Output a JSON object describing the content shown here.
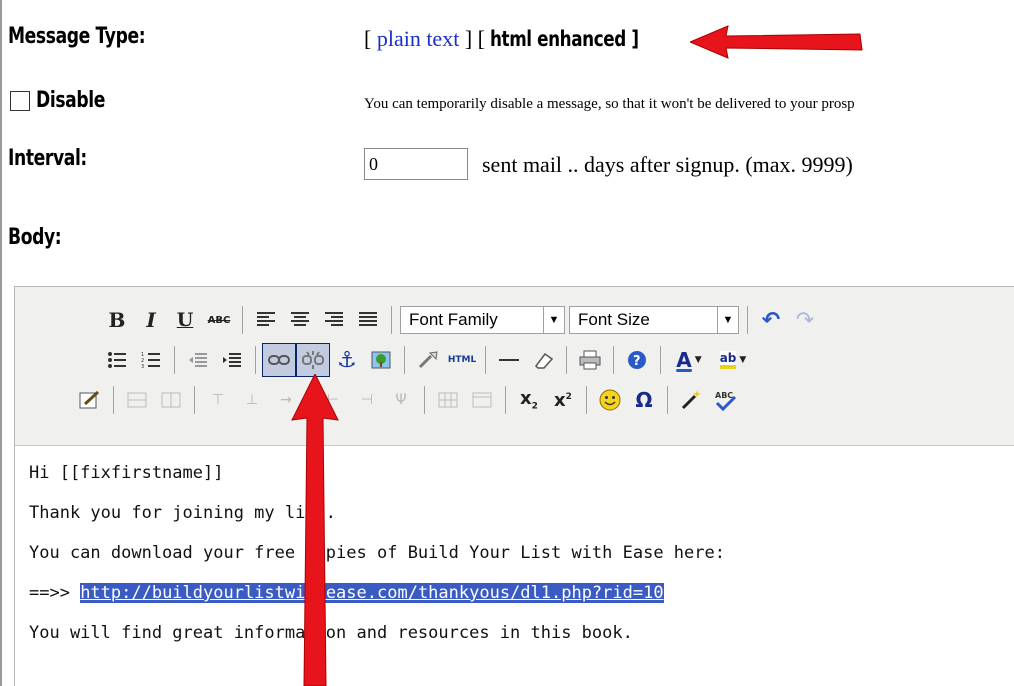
{
  "form": {
    "message_type_label": "Message Type:",
    "message_type": {
      "bracket_open_1": "[ ",
      "plain_text": "plain text",
      "bracket_mid": " ] [ ",
      "html_enhanced": "html enhanced",
      "bracket_close": " ]"
    },
    "disable_label": "Disable",
    "disable_checked": false,
    "disable_hint": "You can temporarily disable a message, so that it won't be delivered to your prosp",
    "interval_label": "Interval:",
    "interval_value": "0",
    "interval_suffix": "sent mail .. days after signup. (max. 9999)",
    "body_label": "Body:"
  },
  "editor": {
    "font_family": "Font Family",
    "font_size": "Font Size",
    "toolbar_row1": [
      "bold",
      "italic",
      "underline",
      "strikethrough",
      "align-left",
      "align-center",
      "align-right",
      "align-justify",
      "font-family",
      "font-size",
      "undo",
      "redo"
    ],
    "toolbar_row2": [
      "bullet-list",
      "numbered-list",
      "outdent",
      "indent",
      "link",
      "unlink",
      "anchor",
      "image",
      "cleanup",
      "html",
      "horizontal-rule",
      "eraser",
      "print",
      "help",
      "text-color",
      "highlight-color"
    ],
    "toolbar_row3": [
      "edit",
      "table-row-props",
      "table-cell-props",
      "insert-row-before",
      "insert-row-after",
      "insert-col-before",
      "insert-col-after",
      "delete-col",
      "split-cells",
      "merge-cells",
      "subscript",
      "superscript",
      "emoticon",
      "special-char",
      "wizard",
      "spellcheck"
    ],
    "html_btn_text": "HTML",
    "content_lines": [
      "Hi [[fixfirstname]]",
      "Thank you for joining my list.",
      "You can download your free copies of Build Your List with Ease here:",
      "==>> ",
      "You will find great information and resources in this book."
    ],
    "link_text": "http://buildyourlistwithease.com/thankyous/dl1.php?rid=10",
    "accent": "#0a246a",
    "arrow_color": "#e8141c"
  }
}
